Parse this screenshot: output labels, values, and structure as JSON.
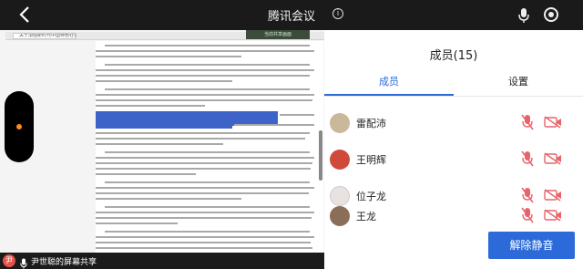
{
  "app": {
    "title": "腾讯会议",
    "info_icon": "info-icon"
  },
  "doc": {
    "tab_label": "关于加强新时代中国特色社会主义文化建设的意见",
    "share_tag": "当前共享画面"
  },
  "share_bar": {
    "sharer_label": "尹世聪的屏幕共享",
    "avatar_letter": "尹"
  },
  "panel": {
    "title": "成员(15)",
    "tabs": [
      {
        "label": "成员",
        "active": true
      },
      {
        "label": "设置",
        "active": false
      }
    ],
    "members": [
      {
        "name": "雷配沛",
        "avatar_color": "#c9b89a",
        "mic_muted": true,
        "camera_off": true
      },
      {
        "name": "王明辉",
        "avatar_color": "#d04a3c",
        "mic_muted": true,
        "camera_off": true
      },
      {
        "name": "位子龙",
        "avatar_color": "#e8e3e0",
        "mic_muted": true,
        "camera_off": true
      },
      {
        "name": "王龙",
        "avatar_color": "#8a6e58",
        "mic_muted": true,
        "camera_off": true
      }
    ],
    "unmute_label": "解除静音"
  },
  "colors": {
    "accent": "#2b6ad8",
    "muted_icon": "#e8646a",
    "highlight": "#3d63c9"
  }
}
